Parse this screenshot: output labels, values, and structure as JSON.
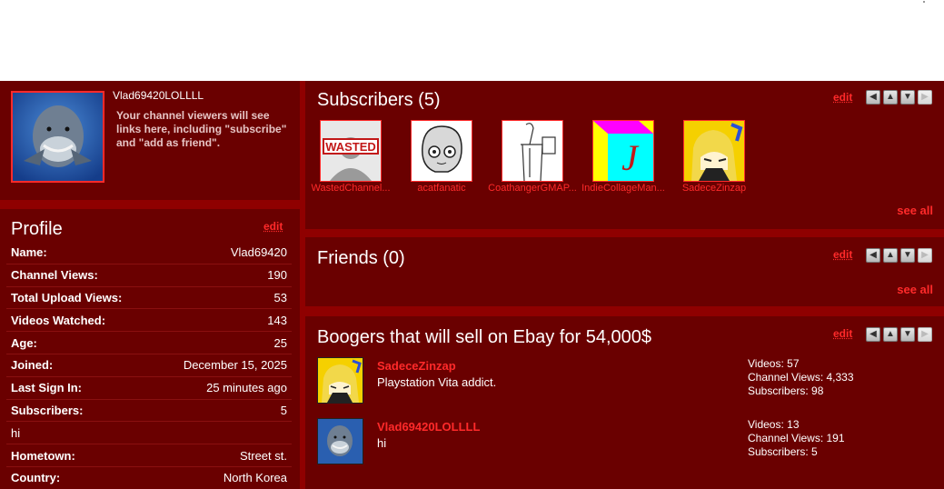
{
  "owner": {
    "username": "Vlad69420LOLLLL",
    "note": "Your channel viewers will see links here, including \"subscribe\" and \"add as friend\"."
  },
  "profile": {
    "title": "Profile",
    "edit_label": "edit",
    "rows": [
      {
        "key": "Name:",
        "value": "Vlad69420"
      },
      {
        "key": "Channel Views:",
        "value": "190"
      },
      {
        "key": "Total Upload Views:",
        "value": "53"
      },
      {
        "key": "Videos Watched:",
        "value": "143"
      },
      {
        "key": "Age:",
        "value": "25"
      },
      {
        "key": "Joined:",
        "value": "December 15, 2025"
      },
      {
        "key": "Last Sign In:",
        "value": "25 minutes ago"
      },
      {
        "key": "Subscribers:",
        "value": "5"
      },
      {
        "key": "hi",
        "value": ""
      },
      {
        "key": "Hometown:",
        "value": "Street st."
      },
      {
        "key": "Country:",
        "value": "North Korea"
      }
    ]
  },
  "subscribers": {
    "title": "Subscribers (5)",
    "edit_label": "edit",
    "see_all": "see all",
    "items": [
      {
        "name": "WastedChannel...",
        "thumb_text": "WASTED"
      },
      {
        "name": "acatfanatic"
      },
      {
        "name": "CoathangerGMAP..."
      },
      {
        "name": "IndieCollageMan...",
        "thumb_text": "J"
      },
      {
        "name": "SadeceZinzap"
      }
    ]
  },
  "friends": {
    "title": "Friends (0)",
    "edit_label": "edit",
    "see_all": "see all"
  },
  "boogers": {
    "title": "Boogers that will sell on Ebay for 54,000$",
    "edit_label": "edit",
    "items": [
      {
        "name": "SadeceZinzap",
        "desc": "Playstation Vita addict.",
        "videos": "Videos: 57",
        "views": "Channel Views: 4,333",
        "subs": "Subscribers: 98"
      },
      {
        "name": "Vlad69420LOLLLL",
        "desc": "hi",
        "videos": "Videos: 13",
        "views": "Channel Views: 191",
        "subs": "Subscribers: 5"
      }
    ]
  },
  "nav_buttons": [
    "chevron-left-icon",
    "chevron-up-icon",
    "chevron-down-icon",
    "chevron-right-icon"
  ],
  "colors": {
    "panel": "#6a0000",
    "frame": "#8f0000",
    "link": "#ff2a2a"
  }
}
